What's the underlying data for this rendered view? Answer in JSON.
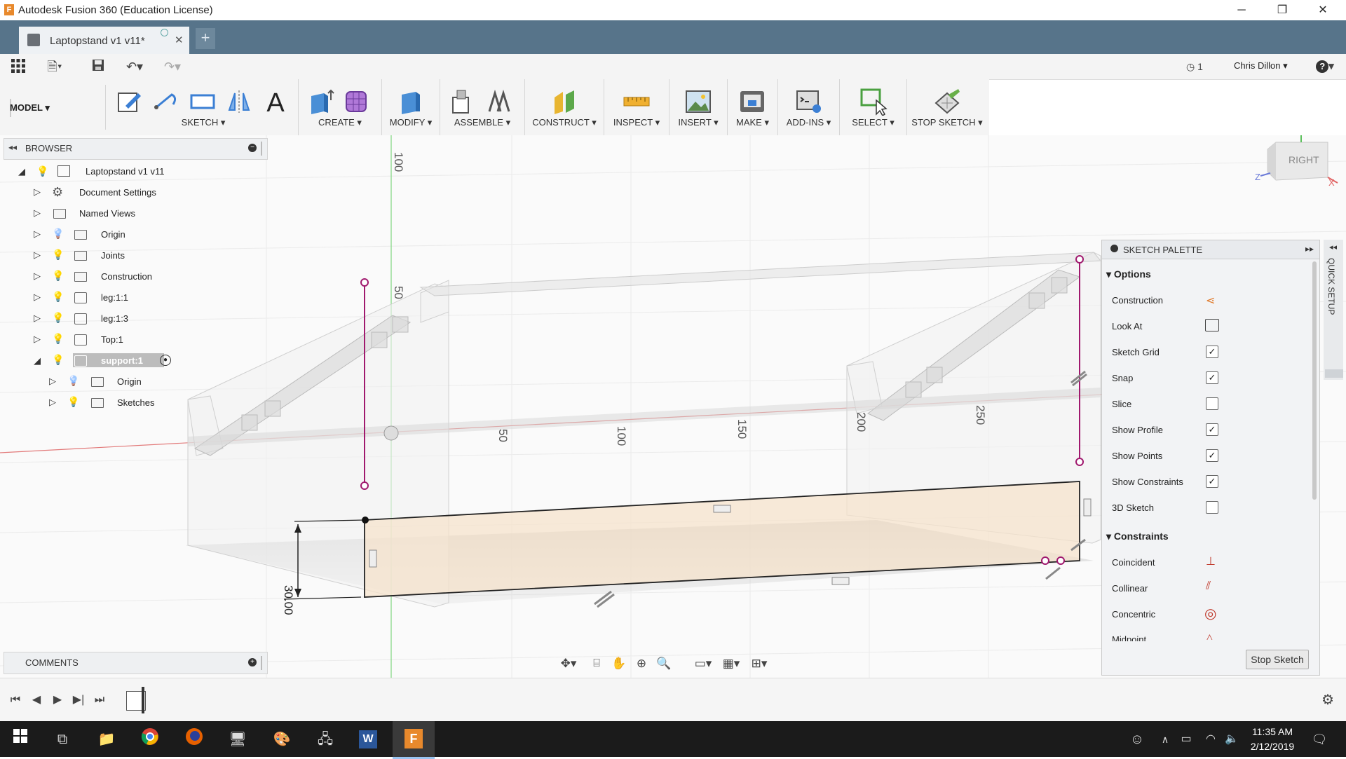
{
  "window": {
    "title": "Autodesk Fusion 360 (Education License)",
    "app_icon_letter": "F"
  },
  "tab": {
    "label": "Laptopstand v1 v11*",
    "close": "✕",
    "new": "+"
  },
  "quick_access": {
    "job_count": "1",
    "user": "Chris Dillon",
    "help": "?"
  },
  "ribbon": {
    "workspace": "MODEL",
    "groups": [
      "SKETCH",
      "CREATE",
      "MODIFY",
      "ASSEMBLE",
      "CONSTRUCT",
      "INSPECT",
      "INSERT",
      "MAKE",
      "ADD-INS",
      "SELECT",
      "STOP SKETCH"
    ]
  },
  "viewcube": {
    "face": "RIGHT",
    "axis_y": "Y",
    "axis_z": "Z",
    "axis_x": "X"
  },
  "browser": {
    "title": "BROWSER",
    "items": [
      {
        "label": "Laptopstand v1 v11"
      },
      {
        "label": "Document Settings"
      },
      {
        "label": "Named Views"
      },
      {
        "label": "Origin"
      },
      {
        "label": "Joints"
      },
      {
        "label": "Construction"
      },
      {
        "label": "leg:1:1"
      },
      {
        "label": "leg:1:3"
      },
      {
        "label": "Top:1"
      },
      {
        "label": "support:1"
      },
      {
        "label": "Origin"
      },
      {
        "label": "Sketches"
      }
    ]
  },
  "canvas": {
    "ruler_labels": [
      "100",
      "50",
      "50",
      "100",
      "150",
      "200",
      "250"
    ],
    "dimension": "30.00"
  },
  "palette": {
    "title": "SKETCH PALETTE",
    "options_header": "Options",
    "options": [
      {
        "label": "Construction",
        "control": "icon"
      },
      {
        "label": "Look At",
        "control": "icon"
      },
      {
        "label": "Sketch Grid",
        "checked": true
      },
      {
        "label": "Snap",
        "checked": true
      },
      {
        "label": "Slice",
        "checked": false
      },
      {
        "label": "Show Profile",
        "checked": true
      },
      {
        "label": "Show Points",
        "checked": true
      },
      {
        "label": "Show Constraints",
        "checked": true
      },
      {
        "label": "3D Sketch",
        "checked": false
      }
    ],
    "constraints_header": "Constraints",
    "constraints": [
      {
        "label": "Coincident"
      },
      {
        "label": "Collinear"
      },
      {
        "label": "Concentric"
      },
      {
        "label": "Midpoint"
      }
    ],
    "stop_button": "Stop Sketch",
    "quick_setup": "QUICK SETUP"
  },
  "comments": {
    "title": "COMMENTS"
  },
  "taskbar": {
    "time": "11:35 AM",
    "date": "2/12/2019"
  },
  "colors": {
    "tab_bar": "#57748a",
    "accent_purple": "#a0196e",
    "fusion_orange": "#e8892c"
  }
}
